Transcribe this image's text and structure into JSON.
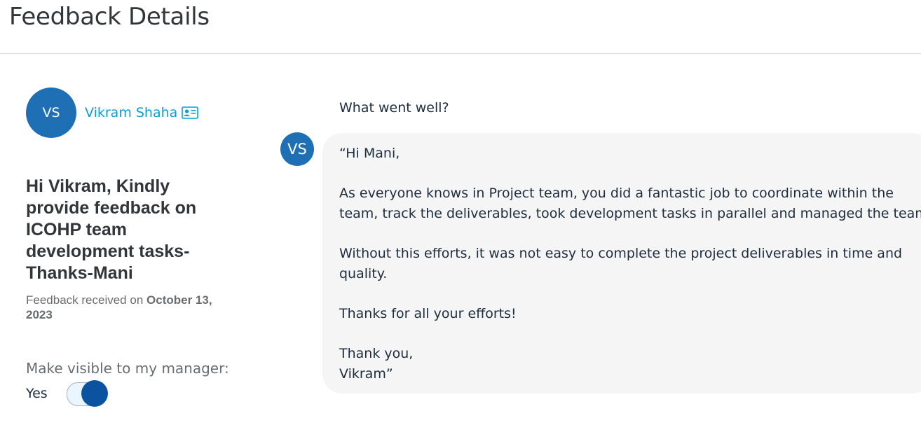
{
  "header": {
    "title": "Feedback Details"
  },
  "author": {
    "initials": "VS",
    "name": "Vikram Shaha",
    "card_icon": "contact-card-icon"
  },
  "feedback": {
    "title": "Hi Vikram, Kindly provide feedback on ICOHP team development tasks-Thanks-Mani",
    "received_prefix": "Feedback received on",
    "received_date": "October 13, 2023"
  },
  "visibility": {
    "label": "Make visible to my manager:",
    "value_text": "Yes",
    "enabled": true
  },
  "response": {
    "question": "What went well?",
    "responder_initials": "VS",
    "lines": {
      "p1l1": "“Hi Mani,",
      "p2l1": "As everyone knows in Project team, you did a fantastic job to coordinate within the",
      "p2l2": "team, track the deliverables, took development tasks in parallel and managed the team.",
      "p3l1": "Without this efforts, it was not easy to complete the project deliverables in time and",
      "p3l2": "quality.",
      "p4l1": "Thanks for all your efforts!",
      "p5l1": "Thank you,",
      "p5l2": "Vikram”"
    }
  },
  "colors": {
    "avatar": "#1f6fb5",
    "link": "#0a9fd6",
    "switch_on": "#0b53a0",
    "bubble_bg": "#f5f5f5"
  }
}
